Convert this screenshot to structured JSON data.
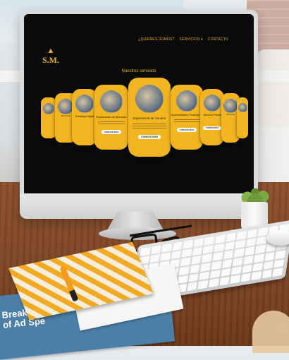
{
  "website": {
    "logo_text": "S.M.",
    "logo_icon": "triangle-icon",
    "nav": [
      "¿QUIENES SOMOS?",
      "SERVICIOS ▾",
      "CONTACTO"
    ],
    "section_title": "Nuestros servicios",
    "cards": [
      {
        "title": "Experiencia de Usuario",
        "button": "CONOCE MÁS"
      },
      {
        "title": "Exploración de Mercado",
        "button": "CONOCE MÁS"
      },
      {
        "title": "Oportunidades Financieras",
        "button": "CONOCE MÁS"
      },
      {
        "title": "Estrategia Digital",
        "button": "CONOCE MÁS"
      },
      {
        "title": "Asesoría Privada",
        "button": "CONOCE MÁS"
      },
      {
        "title": "Servicios",
        "button": ""
      },
      {
        "title": "Recursos",
        "button": ""
      },
      {
        "title": "",
        "button": ""
      },
      {
        "title": "",
        "button": ""
      }
    ]
  },
  "paper": {
    "headline_line1": "Breakdown",
    "headline_line2": "of Ad Spe"
  },
  "colors": {
    "accent": "#f2b51f",
    "screen_bg": "#0a0a0a",
    "desk": "#7a4223"
  }
}
